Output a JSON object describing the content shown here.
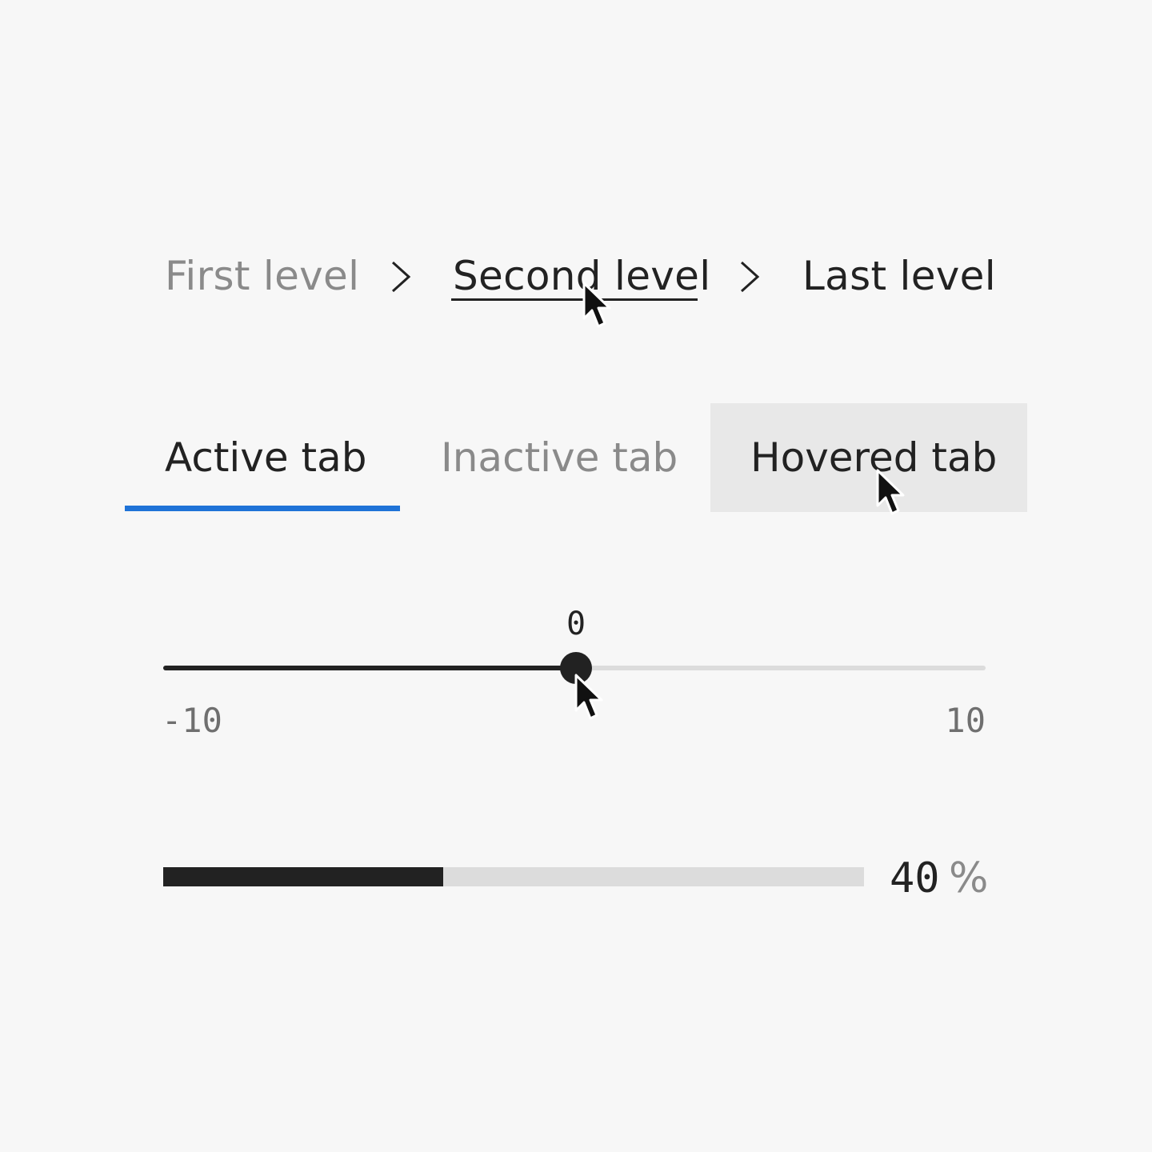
{
  "breadcrumb": {
    "items": [
      {
        "label": "First level"
      },
      {
        "label": "Second level"
      },
      {
        "label": "Last level"
      }
    ],
    "separator_icon": "chevron-right-icon"
  },
  "tabs": {
    "items": [
      {
        "label": "Active tab",
        "state": "active"
      },
      {
        "label": "Inactive tab",
        "state": "inactive"
      },
      {
        "label": "Hovered tab",
        "state": "hovered"
      }
    ],
    "accent_color": "#1f73d7"
  },
  "slider": {
    "value": "0",
    "min": "-10",
    "max": "10"
  },
  "progress": {
    "value": 40,
    "number": "40",
    "unit": "%"
  },
  "colors": {
    "background": "#f7f7f7",
    "text": "#222222",
    "muted": "#8a8a8a",
    "track": "#dcdcdc",
    "hover_bg": "#e8e8e8"
  }
}
